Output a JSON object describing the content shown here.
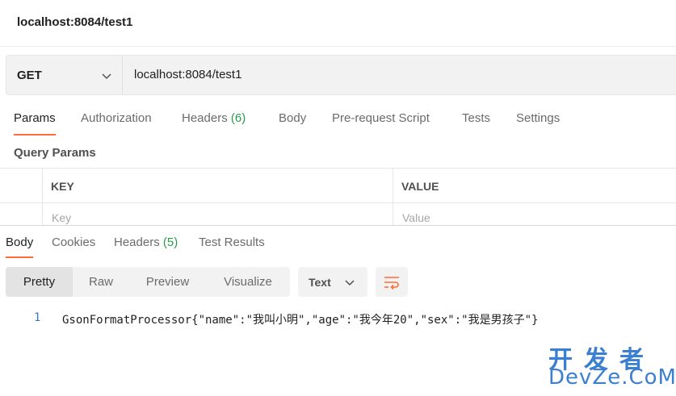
{
  "titlebar": {
    "title": "localhost:8084/test1"
  },
  "request": {
    "method": "GET",
    "url": "localhost:8084/test1"
  },
  "request_tabs": [
    {
      "label": "Params",
      "active": true
    },
    {
      "label": "Authorization"
    },
    {
      "label": "Headers",
      "count": "(6)"
    },
    {
      "label": "Body"
    },
    {
      "label": "Pre-request Script"
    },
    {
      "label": "Tests"
    },
    {
      "label": "Settings"
    }
  ],
  "query_params": {
    "heading": "Query Params",
    "key_header": "KEY",
    "value_header": "VALUE",
    "key_placeholder": "Key",
    "value_placeholder": "Value"
  },
  "response_tabs": [
    {
      "label": "Body",
      "active": true
    },
    {
      "label": "Cookies"
    },
    {
      "label": "Headers",
      "count": "(5)"
    },
    {
      "label": "Test Results"
    }
  ],
  "view_modes": [
    "Pretty",
    "Raw",
    "Preview",
    "Visualize"
  ],
  "format": "Text",
  "code": {
    "line_number": "1",
    "line_text": "GsonFormatProcessor{\"name\":\"我叫小明\",\"age\":\"我今年20\",\"sex\":\"我是男孩子\"}"
  },
  "watermark": {
    "cn": "开发者",
    "en": "DevZe.CoM"
  },
  "colors": {
    "accent": "#ff6c37",
    "count_green": "#2b9a4a",
    "line_number": "#3a7bbf",
    "watermark": "#3b7fd0"
  }
}
